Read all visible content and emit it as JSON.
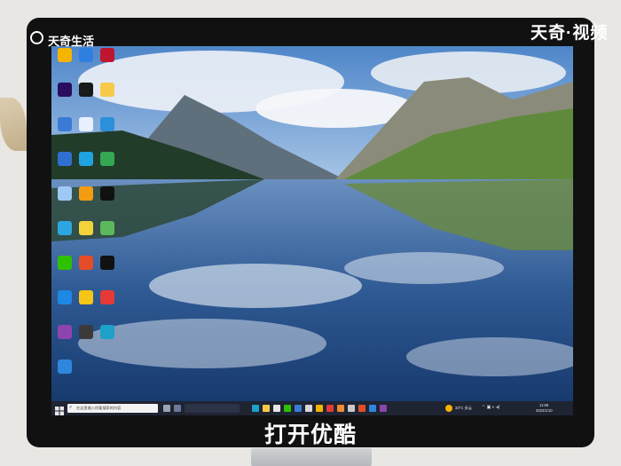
{
  "watermark": {
    "top_left_logo": "天奇生活",
    "top_right_brand": "天奇·视频"
  },
  "caption": "打开优酷",
  "desktop": {
    "icons": [
      {
        "name": "app-icon-1",
        "color": "#f4b400"
      },
      {
        "name": "app-icon-2",
        "color": "#2e7fe0"
      },
      {
        "name": "app-icon-3",
        "color": "#c0152f"
      },
      {
        "name": "premiere-icon",
        "color": "#2a0d5e"
      },
      {
        "name": "qq-icon",
        "color": "#1a1a1a"
      },
      {
        "name": "app-icon-6",
        "color": "#f7c948"
      },
      {
        "name": "network-icon",
        "color": "#3a7bd5"
      },
      {
        "name": "app-icon-8",
        "color": "#e8f0ff"
      },
      {
        "name": "app-icon-9",
        "color": "#2b8fd9"
      },
      {
        "name": "app-icon-10",
        "color": "#2f6fd1"
      },
      {
        "name": "app-icon-11",
        "color": "#1fa3e0"
      },
      {
        "name": "app-icon-12",
        "color": "#34a853"
      },
      {
        "name": "recycle-bin-icon",
        "color": "#9ec9f2"
      },
      {
        "name": "app-icon-14",
        "color": "#f39c12"
      },
      {
        "name": "tiktok-icon",
        "color": "#111111"
      },
      {
        "name": "app-icon-16",
        "color": "#2ca6e0"
      },
      {
        "name": "app-icon-17",
        "color": "#f2d43a"
      },
      {
        "name": "app-icon-18",
        "color": "#5cb85c"
      },
      {
        "name": "wechat-icon",
        "color": "#2dc100"
      },
      {
        "name": "app-icon-20",
        "color": "#e44d26"
      },
      {
        "name": "capcut-icon",
        "color": "#111111"
      },
      {
        "name": "shield-icon",
        "color": "#1e88e5"
      },
      {
        "name": "app-icon-23",
        "color": "#f5c518"
      },
      {
        "name": "app-icon-24",
        "color": "#e53935"
      },
      {
        "name": "app-icon-25",
        "color": "#8e44ad"
      },
      {
        "name": "app-icon-26",
        "color": "#3a3a3a"
      },
      {
        "name": "edge-icon",
        "color": "#1da1c8"
      },
      {
        "name": "app-icon-28",
        "color": "#2e86de"
      }
    ]
  },
  "taskbar": {
    "search_placeholder": "在这里输入你要搜索的内容",
    "tray": {
      "weather": "33°C 多云",
      "time": "11:58",
      "date": "2022/1/10"
    }
  }
}
